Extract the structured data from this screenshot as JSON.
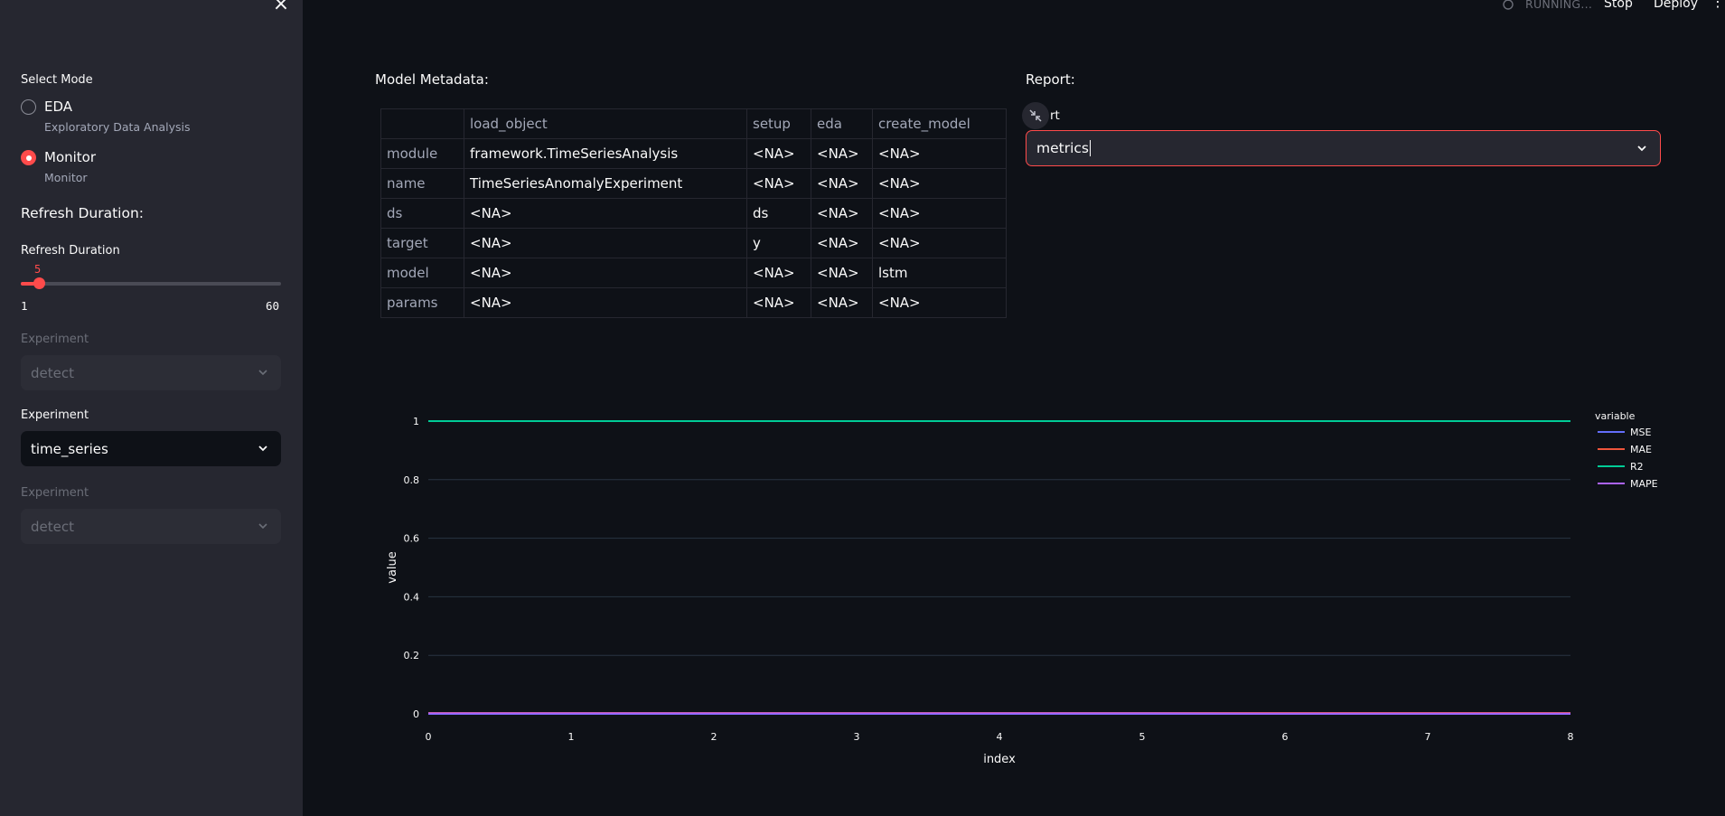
{
  "sidebar": {
    "close_icon": "close-icon",
    "select_mode_label": "Select Mode",
    "modes": [
      {
        "title": "EDA",
        "subtitle": "Exploratory Data Analysis",
        "checked": false
      },
      {
        "title": "Monitor",
        "subtitle": "Monitor",
        "checked": true
      }
    ],
    "refresh_heading": "Refresh Duration:",
    "slider": {
      "label": "Refresh Duration",
      "value": "5",
      "min": "1",
      "max": "60",
      "fraction": 0.068
    },
    "experiments": [
      {
        "label": "Experiment",
        "value": "detect",
        "disabled": true
      },
      {
        "label": "Experiment",
        "value": "time_series",
        "disabled": false
      },
      {
        "label": "Experiment",
        "value": "detect",
        "disabled": true
      }
    ]
  },
  "topbar": {
    "status": "RUNNING...",
    "stop_label": "Stop",
    "deploy_label": "Deploy",
    "menu_icon": "⋮"
  },
  "main": {
    "metadata_title": "Model Metadata:",
    "report_title": "Report:",
    "report_label_fragment": "rt",
    "report_value": "metrics",
    "table": {
      "columns": [
        "",
        "load_object",
        "setup",
        "eda",
        "create_model"
      ],
      "rows": [
        [
          "module",
          "framework.TimeSeriesAnalysis",
          "<NA>",
          "<NA>",
          "<NA>"
        ],
        [
          "name",
          "TimeSeriesAnomalyExperiment",
          "<NA>",
          "<NA>",
          "<NA>"
        ],
        [
          "ds",
          "<NA>",
          "ds",
          "<NA>",
          "<NA>"
        ],
        [
          "target",
          "<NA>",
          "y",
          "<NA>",
          "<NA>"
        ],
        [
          "model",
          "<NA>",
          "<NA>",
          "<NA>",
          "lstm"
        ],
        [
          "params",
          "<NA>",
          "<NA>",
          "<NA>",
          "<NA>"
        ]
      ]
    }
  },
  "chart_data": {
    "type": "line",
    "xlabel": "index",
    "ylabel": "value",
    "x": [
      0,
      1,
      2,
      3,
      4,
      5,
      6,
      7,
      8
    ],
    "xlim": [
      0,
      8
    ],
    "ylim": [
      0,
      1
    ],
    "xticks": [
      "0",
      "1",
      "2",
      "3",
      "4",
      "5",
      "6",
      "7",
      "8"
    ],
    "yticks": [
      "0",
      "0.2",
      "0.4",
      "0.6",
      "0.8",
      "1"
    ],
    "legend_title": "variable",
    "legend_position": "right",
    "grid": true,
    "series": [
      {
        "name": "MSE",
        "color": "#636efa",
        "values": [
          0,
          0,
          0,
          0,
          0,
          0,
          0,
          0,
          0
        ]
      },
      {
        "name": "MAE",
        "color": "#ef553b",
        "values": [
          0.003,
          0.003,
          0.003,
          0.003,
          0.003,
          0.003,
          0.003,
          0.003,
          0.003
        ]
      },
      {
        "name": "R2",
        "color": "#00cc96",
        "values": [
          1,
          1,
          1,
          1,
          1,
          1,
          1,
          1,
          1
        ]
      },
      {
        "name": "MAPE",
        "color": "#ab63fa",
        "values": [
          0.002,
          0.002,
          0.002,
          0.002,
          0.002,
          0.002,
          0.001,
          0.001,
          0.001
        ]
      }
    ]
  }
}
